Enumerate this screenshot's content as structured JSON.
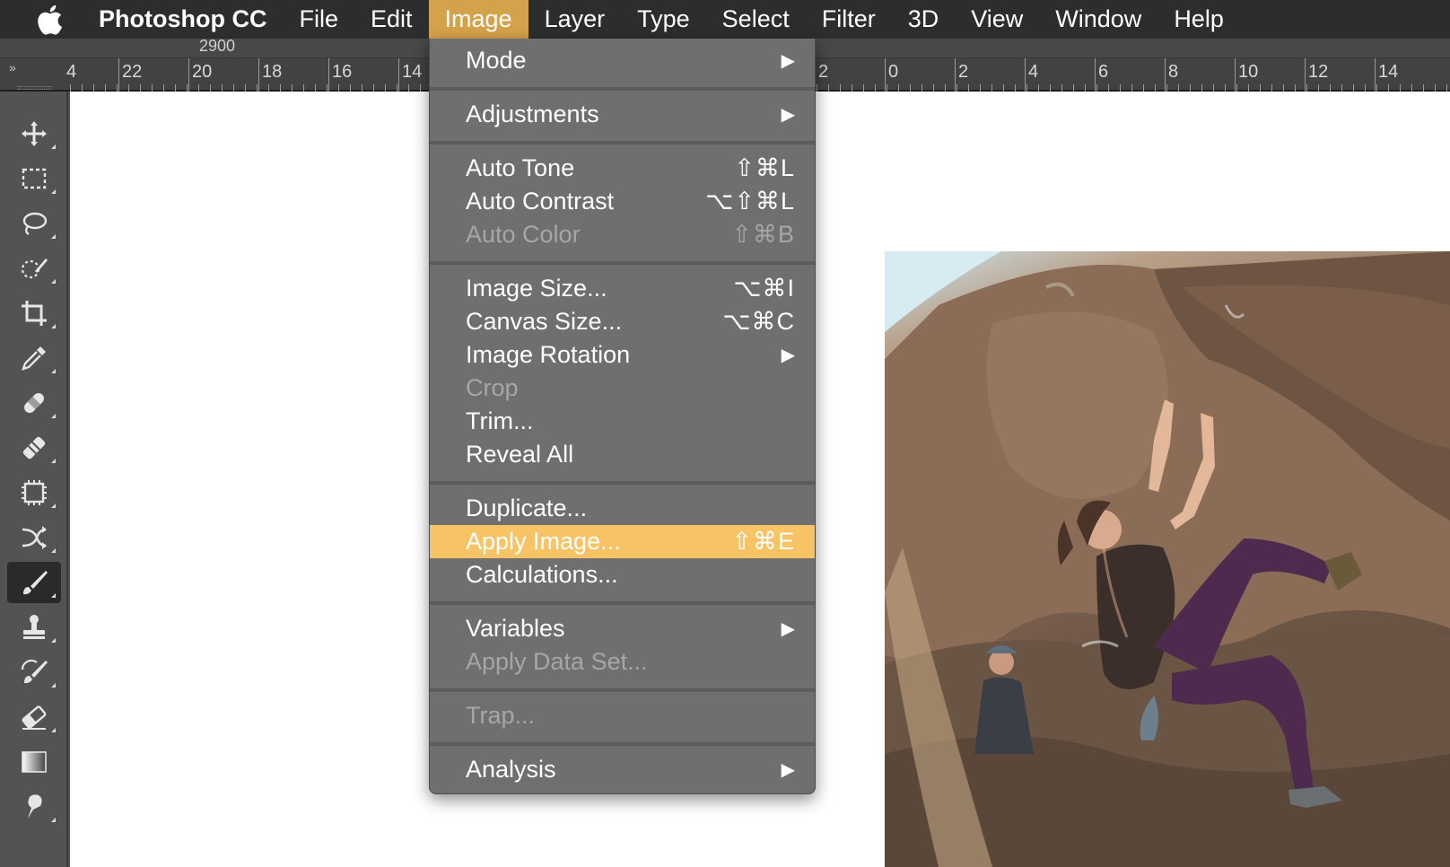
{
  "menubar": {
    "apple_icon": "apple-logo-icon",
    "app_name": "Photoshop CC",
    "items": [
      {
        "label": "File"
      },
      {
        "label": "Edit"
      },
      {
        "label": "Image"
      },
      {
        "label": "Layer"
      },
      {
        "label": "Type"
      },
      {
        "label": "Select"
      },
      {
        "label": "Filter"
      },
      {
        "label": "3D"
      },
      {
        "label": "View"
      },
      {
        "label": "Window"
      },
      {
        "label": "Help"
      }
    ],
    "active_item": "Image",
    "active_color": "#d4a24a"
  },
  "optionsbar": {
    "value": "2900"
  },
  "ruler": {
    "left_labels": [
      "4",
      "22",
      "20",
      "18",
      "16",
      "14"
    ],
    "right_labels": [
      "2",
      "0",
      "2",
      "4",
      "6",
      "8",
      "10",
      "12",
      "14"
    ]
  },
  "toolbar": {
    "tools": [
      {
        "name": "move-tool-icon"
      },
      {
        "name": "marquee-tool-icon"
      },
      {
        "name": "lasso-tool-icon"
      },
      {
        "name": "quick-selection-tool-icon"
      },
      {
        "name": "crop-tool-icon"
      },
      {
        "name": "eyedropper-tool-icon"
      },
      {
        "name": "spot-healing-tool-icon"
      },
      {
        "name": "healing-brush-tool-icon"
      },
      {
        "name": "content-aware-tool-icon"
      },
      {
        "name": "red-eye-tool-icon"
      },
      {
        "name": "brush-tool-icon",
        "selected": true
      },
      {
        "name": "clone-stamp-tool-icon"
      },
      {
        "name": "history-brush-tool-icon"
      },
      {
        "name": "eraser-tool-icon"
      },
      {
        "name": "gradient-tool-icon"
      },
      {
        "name": "smudge-tool-icon"
      }
    ]
  },
  "image_menu": {
    "highlight_color": "#f8c364",
    "mode": {
      "label": "Mode",
      "submenu": true
    },
    "adjustments": {
      "label": "Adjustments",
      "submenu": true
    },
    "auto_tone": {
      "label": "Auto Tone",
      "shortcut": "⇧⌘L"
    },
    "auto_contrast": {
      "label": "Auto Contrast",
      "shortcut": "⌥⇧⌘L"
    },
    "auto_color": {
      "label": "Auto Color",
      "shortcut": "⇧⌘B",
      "disabled": true
    },
    "image_size": {
      "label": "Image Size...",
      "shortcut": "⌥⌘I"
    },
    "canvas_size": {
      "label": "Canvas Size...",
      "shortcut": "⌥⌘C"
    },
    "image_rotation": {
      "label": "Image Rotation",
      "submenu": true
    },
    "crop": {
      "label": "Crop",
      "disabled": true
    },
    "trim": {
      "label": "Trim..."
    },
    "reveal_all": {
      "label": "Reveal All"
    },
    "duplicate": {
      "label": "Duplicate..."
    },
    "apply_image": {
      "label": "Apply Image...",
      "shortcut": "⇧⌘E",
      "highlighted": true
    },
    "calculations": {
      "label": "Calculations..."
    },
    "variables": {
      "label": "Variables",
      "submenu": true
    },
    "apply_data_set": {
      "label": "Apply Data Set...",
      "disabled": true
    },
    "trap": {
      "label": "Trap...",
      "disabled": true
    },
    "analysis": {
      "label": "Analysis",
      "submenu": true
    },
    "submenu_arrow": "▶"
  },
  "canvas": {
    "photo_subject": "rock-climber-photo"
  }
}
